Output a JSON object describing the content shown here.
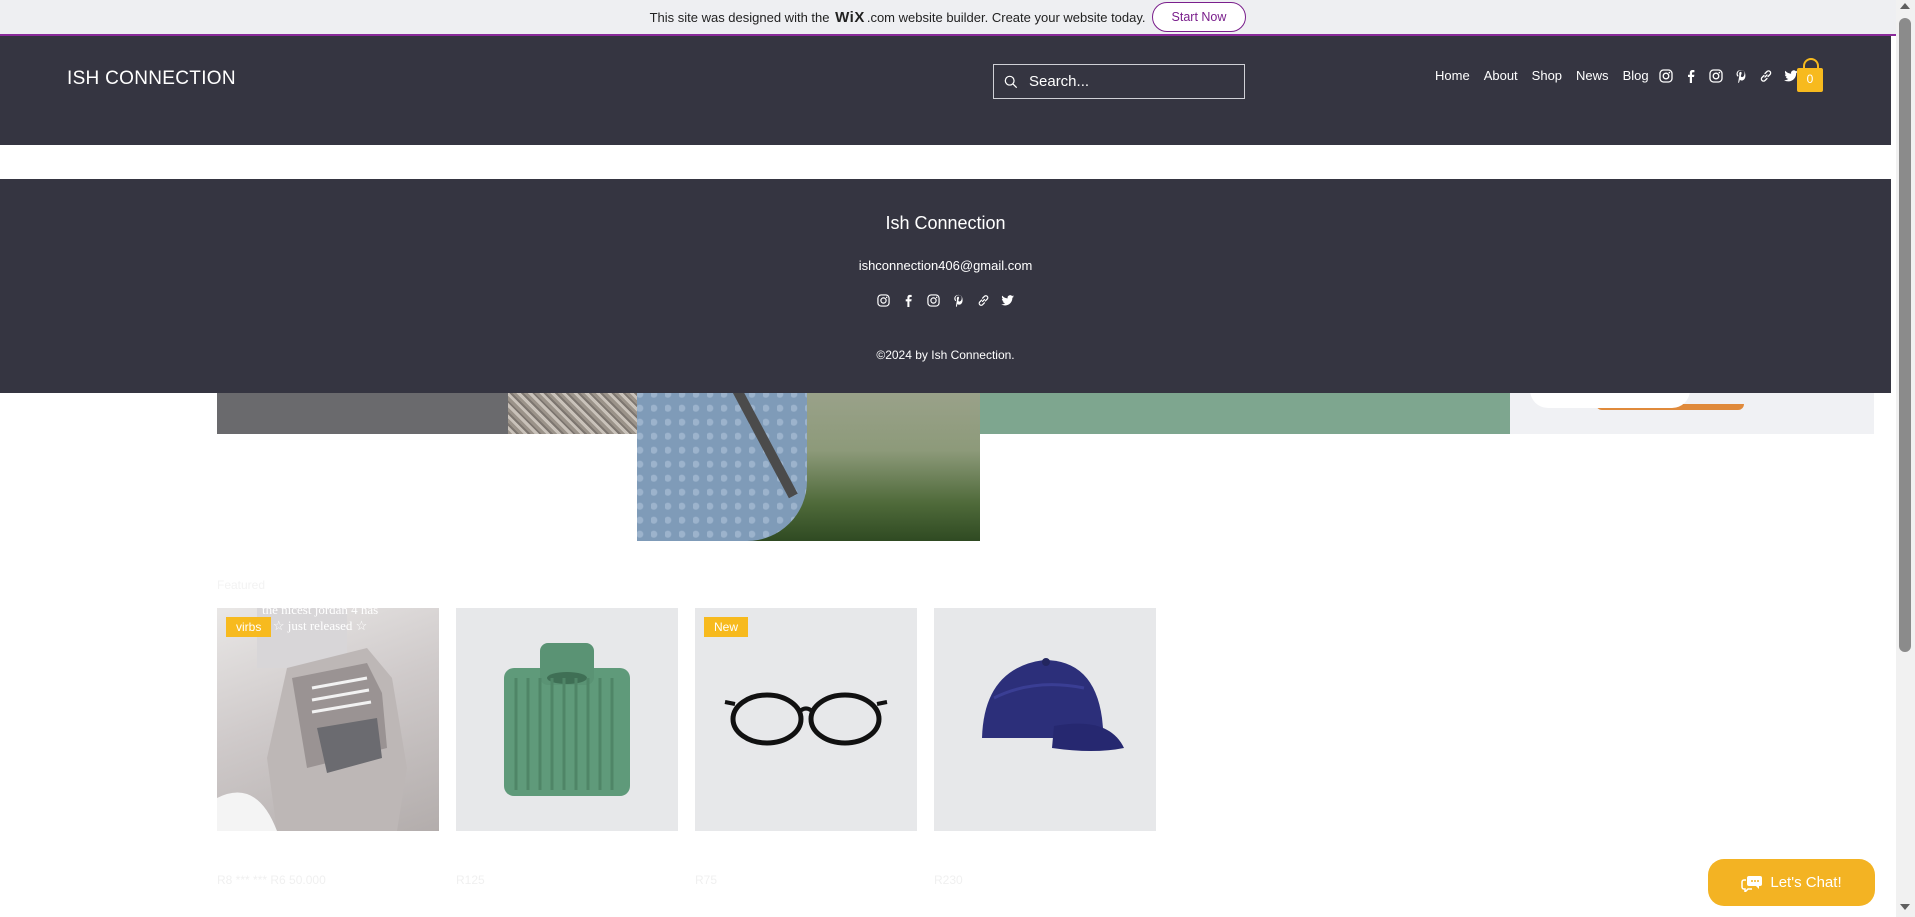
{
  "wix_banner": {
    "text_before": "This site was designed with the",
    "logo": "WiX",
    "logo_suffix": ".com",
    "text_after": "website builder. Create your website today.",
    "cta": "Start Now"
  },
  "header": {
    "brand": "ISH CONNECTION",
    "search_placeholder": "Search...",
    "nav": [
      "Home",
      "About",
      "Shop",
      "News",
      "Blog"
    ],
    "social_icons": [
      "instagram-icon",
      "facebook-icon",
      "instagram-icon",
      "pinterest-icon",
      "link-icon",
      "twitter-icon"
    ],
    "cart_count": "0"
  },
  "footer": {
    "name": "Ish Connection",
    "email": "ishconnection406@gmail.com",
    "social_icons": [
      "instagram-icon",
      "facebook-icon",
      "instagram-icon",
      "pinterest-icon",
      "link-icon",
      "twitter-icon"
    ],
    "copyright": "©2024 by Ish Connection."
  },
  "products": {
    "section_title": "Featured",
    "items": [
      {
        "ribbon": "virbs",
        "caption_line1": "the nicest jordan 4 has",
        "caption_line2": "☆ just released ☆",
        "price": "R8 *** *** R6 50.000"
      },
      {
        "ribbon": "",
        "price": "R125"
      },
      {
        "ribbon": "New",
        "price": "R75"
      },
      {
        "ribbon": "",
        "price": "R230"
      }
    ]
  },
  "chat": {
    "label": "Let's Chat!"
  },
  "colors": {
    "header_bg": "#353541",
    "accent": "#f7ba1e",
    "wix_purple": "#7a1f8c"
  }
}
